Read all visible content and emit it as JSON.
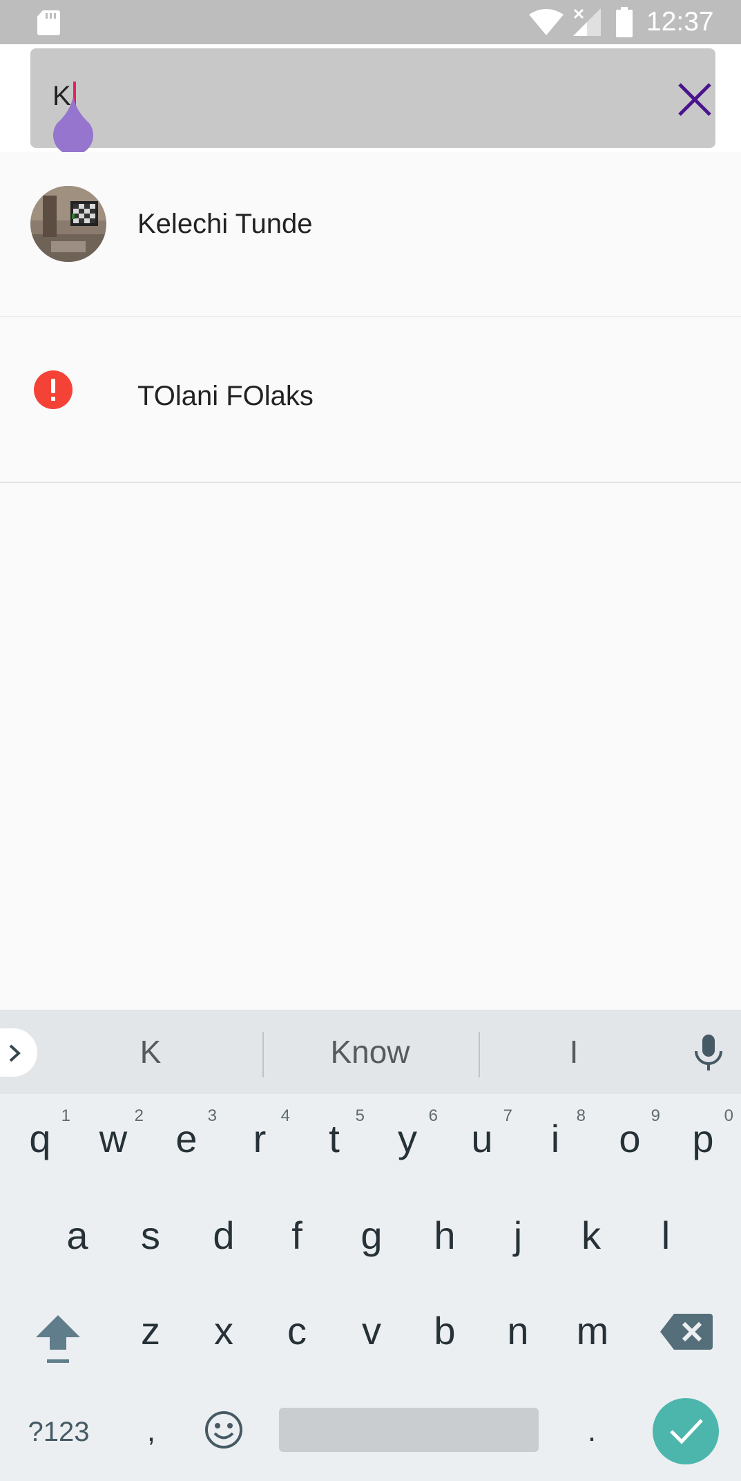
{
  "status_bar": {
    "time": "12:37"
  },
  "search": {
    "query": "K"
  },
  "results": [
    {
      "name": "Kelechi Tunde",
      "avatar": "photo-avatar"
    },
    {
      "name": "TOlani FOlaks",
      "avatar": "alert-icon"
    }
  ],
  "keyboard": {
    "suggestions": [
      "K",
      "Know",
      "I"
    ],
    "row1": [
      {
        "char": "q",
        "hint": "1"
      },
      {
        "char": "w",
        "hint": "2"
      },
      {
        "char": "e",
        "hint": "3"
      },
      {
        "char": "r",
        "hint": "4"
      },
      {
        "char": "t",
        "hint": "5"
      },
      {
        "char": "y",
        "hint": "6"
      },
      {
        "char": "u",
        "hint": "7"
      },
      {
        "char": "i",
        "hint": "8"
      },
      {
        "char": "o",
        "hint": "9"
      },
      {
        "char": "p",
        "hint": "0"
      }
    ],
    "row2": [
      "a",
      "s",
      "d",
      "f",
      "g",
      "h",
      "j",
      "k",
      "l"
    ],
    "row3": [
      "z",
      "x",
      "c",
      "v",
      "b",
      "n",
      "m"
    ],
    "symbols_label": "?123",
    "comma": ",",
    "period": "."
  },
  "colors": {
    "status_bar": "#bdbdbd",
    "search_box": "#c8c8c8",
    "clear_icon": "#4a148c",
    "caret": "#e91e63",
    "cursor_handle": "#9575cd",
    "alert": "#f44336",
    "done_key": "#4db6ac"
  }
}
